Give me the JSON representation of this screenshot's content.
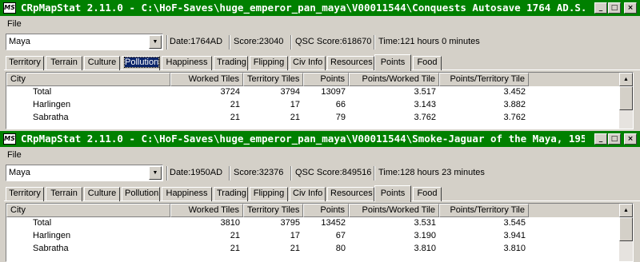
{
  "tabs": [
    "Territory",
    "Terrain",
    "Culture",
    "Pollution",
    "Happiness",
    "Trading",
    "Flipping",
    "Civ Info",
    "Resources",
    "Points",
    "Food"
  ],
  "columns": [
    "City",
    "Worked Tiles",
    "Territory Tiles",
    "Points",
    "Points/Worked Tile",
    "Points/Territory Tile"
  ],
  "windows": [
    {
      "title": "CRpMapStat 2.11.0 - C:\\HoF-Saves\\huge_emperor_pan_maya\\V00011544\\Conquests Autosave 1764 AD.S...",
      "menu": "File",
      "civ": "Maya",
      "date": "Date:1764AD",
      "score": "Score:23040",
      "qsc": "QSC Score:618670",
      "time": "Time:121 hours 0 minutes",
      "active_tab": "Points",
      "rows": [
        [
          "Total",
          "3724",
          "3794",
          "13097",
          "3.517",
          "3.452"
        ],
        [
          "Harlingen",
          "21",
          "17",
          "66",
          "3.143",
          "3.882"
        ],
        [
          "Sabratha",
          "21",
          "21",
          "79",
          "3.762",
          "3.762"
        ],
        [
          "",
          "",
          "",
          "",
          "",
          ""
        ]
      ]
    },
    {
      "title": "CRpMapStat 2.11.0 - C:\\HoF-Saves\\huge_emperor_pan_maya\\V00011544\\Smoke-Jaguar of the Maya, 195...",
      "menu": "File",
      "civ": "Maya",
      "date": "Date:1950AD",
      "score": "Score:32376",
      "qsc": "QSC Score:849516",
      "time": "Time:128 hours 23 minutes",
      "active_tab": "Points",
      "rows": [
        [
          "Total",
          "3810",
          "3795",
          "13452",
          "3.531",
          "3.545"
        ],
        [
          "Harlingen",
          "21",
          "17",
          "67",
          "3.190",
          "3.941"
        ],
        [
          "Sabratha",
          "21",
          "21",
          "80",
          "3.810",
          "3.810"
        ],
        [
          "",
          "",
          "",
          "",
          "",
          ""
        ]
      ]
    }
  ],
  "icons": {
    "app": "MS",
    "minimize": "_",
    "maximize": "□",
    "close": "×",
    "dropdown": "▼",
    "scroll_up": "▲"
  },
  "colors": {
    "titlebar": "#008000",
    "face": "#d4d0c8",
    "focus": "#0a246a"
  }
}
